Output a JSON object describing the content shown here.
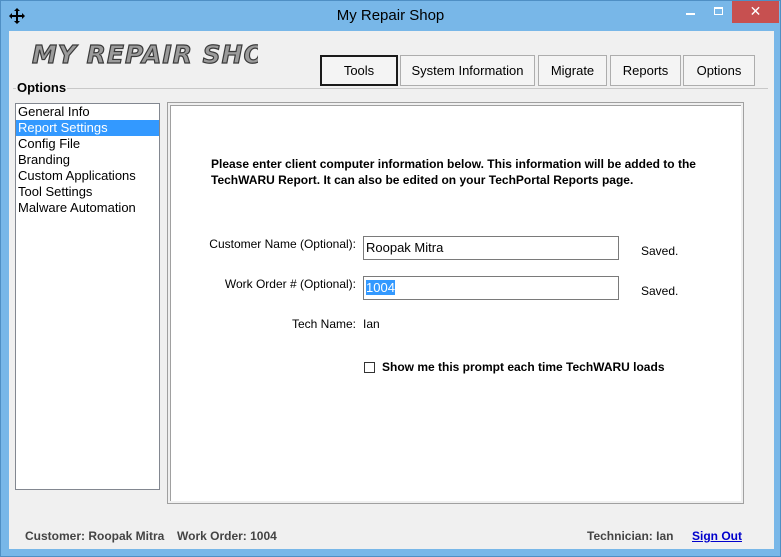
{
  "window": {
    "title": "My Repair Shop",
    "close_glyph": "✕"
  },
  "logo": {
    "text": "MY REPAIR SHOP"
  },
  "tabs": [
    {
      "label": "Tools",
      "active": true
    },
    {
      "label": "System Information",
      "active": false
    },
    {
      "label": "Migrate",
      "active": false
    },
    {
      "label": "Reports",
      "active": false
    },
    {
      "label": "Options",
      "active": false
    }
  ],
  "options": {
    "group_label": "Options",
    "items": [
      {
        "label": "General Info",
        "selected": false
      },
      {
        "label": "Report Settings",
        "selected": true
      },
      {
        "label": "Config File",
        "selected": false
      },
      {
        "label": "Branding",
        "selected": false
      },
      {
        "label": "Custom Applications",
        "selected": false
      },
      {
        "label": "Tool Settings",
        "selected": false
      },
      {
        "label": "Malware Automation",
        "selected": false
      }
    ]
  },
  "report": {
    "intro_line1": "Please enter client computer information below. This information will be added to the",
    "intro_line2": "TechWARU Report. It can also be edited on your TechPortal Reports page.",
    "customer_label": "Customer Name (Optional):",
    "customer_value": "Roopak Mitra",
    "customer_status": "Saved.",
    "workorder_label": "Work Order # (Optional):",
    "workorder_value": "1004",
    "workorder_status": "Saved.",
    "tech_label": "Tech Name:",
    "tech_value": "Ian",
    "prompt_checkbox_label": "Show me this prompt each time TechWARU loads",
    "prompt_checked": false
  },
  "status": {
    "customer": "Customer: Roopak Mitra",
    "work_order": "Work Order: 1004",
    "technician": "Technician: Ian",
    "sign_out": "Sign Out"
  },
  "colors": {
    "titlebar": "#78b7e8",
    "close": "#c75050",
    "selection": "#3399ff",
    "link": "#0000cc"
  }
}
